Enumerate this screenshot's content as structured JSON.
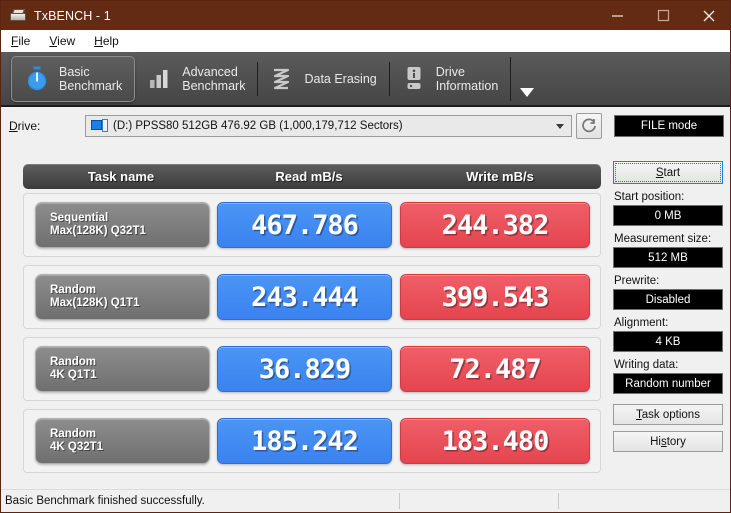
{
  "window": {
    "title": "TxBENCH - 1",
    "icon": "drive-icon",
    "minimize_label": "—",
    "maximize_label": "□",
    "close_label": "✕"
  },
  "menubar": {
    "items": [
      {
        "label": "File",
        "accel": "F"
      },
      {
        "label": "View",
        "accel": "V"
      },
      {
        "label": "Help",
        "accel": "H"
      }
    ]
  },
  "ribbon": {
    "tabs": [
      {
        "id": "basic-benchmark",
        "line1": "Basic",
        "line2": "Benchmark",
        "icon": "stopwatch-icon",
        "active": true
      },
      {
        "id": "advanced-benchmark",
        "line1": "Advanced",
        "line2": "Benchmark",
        "icon": "bar-chart-icon",
        "active": false
      },
      {
        "id": "data-erasing",
        "line1": "Data Erasing",
        "line2": "",
        "icon": "eraser-wave-icon",
        "active": false
      },
      {
        "id": "drive-information",
        "line1": "Drive",
        "line2": "Information",
        "icon": "drive-info-icon",
        "active": false
      }
    ],
    "overflow_icon": "caret-down-icon"
  },
  "drivebar": {
    "label": "Drive:",
    "selected_drive": "(D:) PPSS80 512GB  476.92 GB (1,000,179,712 Sectors)",
    "drive_icon": "hard-disk-icon",
    "dropdown_icon": "chevron-down-icon",
    "refresh_icon": "refresh-icon",
    "mode_badge": "FILE mode"
  },
  "results": {
    "columns": [
      "Task name",
      "Read mB/s",
      "Write mB/s"
    ],
    "rows": [
      {
        "task_line1": "Sequential",
        "task_line2": "Max(128K) Q32T1",
        "read": "467.786",
        "write": "244.382"
      },
      {
        "task_line1": "Random",
        "task_line2": "Max(128K) Q1T1",
        "read": "243.444",
        "write": "399.543"
      },
      {
        "task_line1": "Random",
        "task_line2": "4K Q1T1",
        "read": "36.829",
        "write": "72.487"
      },
      {
        "task_line1": "Random",
        "task_line2": "4K Q32T1",
        "read": "185.242",
        "write": "183.480"
      }
    ]
  },
  "sidepanel": {
    "start_button": "Start",
    "start_position_label": "Start position:",
    "start_position_value": "0 MB",
    "measurement_size_label": "Measurement size:",
    "measurement_size_value": "512 MB",
    "prewrite_label": "Prewrite:",
    "prewrite_value": "Disabled",
    "alignment_label": "Alignment:",
    "alignment_value": "4 KB",
    "writing_data_label": "Writing data:",
    "writing_data_value": "Random number",
    "task_options_button": "Task options",
    "history_button": "History"
  },
  "statusbar": {
    "message": "Basic Benchmark finished successfully.",
    "segment2": "",
    "segment3": ""
  },
  "colors": {
    "titlebar": "#632b13",
    "ribbon": "#4e4e4e",
    "read_accent": "#3f8bf2",
    "write_accent": "#e9474f",
    "task_gray": "#7d7d7d",
    "badge_bg": "#000000"
  }
}
